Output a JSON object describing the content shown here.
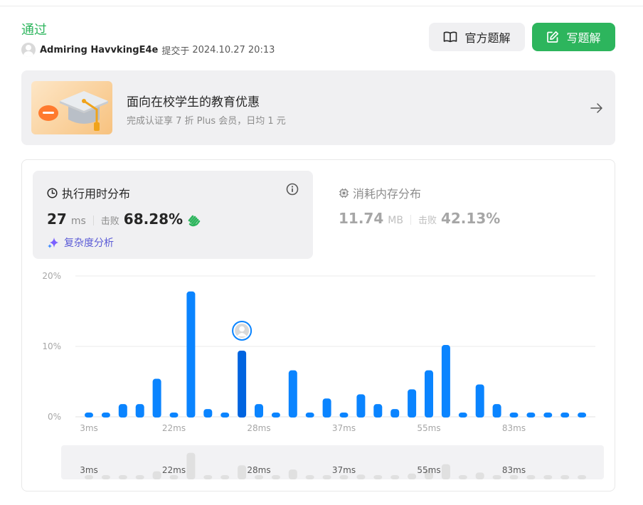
{
  "header": {
    "status": "通过",
    "username": "Admiring HavvkingE4e",
    "submitted_label": "提交于",
    "submitted_time": "2024.10.27 20:13",
    "official_solution_label": "官方题解",
    "write_solution_label": "写题解"
  },
  "banner": {
    "title": "面向在校学生的教育优惠",
    "subtitle": "完成认证享 7 折 Plus 会员，日均 1 元"
  },
  "runtime": {
    "title": "执行用时分布",
    "value": "27",
    "unit": "ms",
    "beat_label": "击败",
    "beat_value": "68.28%",
    "complexity_link": "复杂度分析"
  },
  "memory": {
    "title": "消耗内存分布",
    "value": "11.74",
    "unit": "MB",
    "beat_label": "击败",
    "beat_value": "42.13%"
  },
  "colors": {
    "accepted": "#2db55d",
    "bar": "#0a84ff",
    "bar_active": "#0064e0",
    "minimap_bar": "#e0e0e0"
  },
  "chart_data": {
    "type": "bar",
    "title": "",
    "xlabel": "",
    "ylabel": "",
    "y_ticks": [
      "0%",
      "10%",
      "20%"
    ],
    "ylim": [
      0,
      20
    ],
    "x_tick_labels": [
      {
        "index": 0,
        "label": "3ms"
      },
      {
        "index": 5,
        "label": "22ms"
      },
      {
        "index": 10,
        "label": "28ms"
      },
      {
        "index": 15,
        "label": "37ms"
      },
      {
        "index": 20,
        "label": "55ms"
      },
      {
        "index": 25,
        "label": "83ms"
      }
    ],
    "values": [
      0.5,
      0.5,
      1.8,
      1.8,
      5.4,
      0.5,
      17.8,
      1.1,
      0.5,
      9.4,
      1.8,
      0.5,
      6.6,
      0.5,
      2.6,
      0.5,
      3.2,
      1.8,
      1.1,
      3.9,
      6.6,
      10.2,
      0.5,
      4.6,
      1.8,
      0.5,
      0.5,
      0.5,
      0.5,
      0.5
    ],
    "highlight_index": 9,
    "grid": true,
    "legend": "none"
  },
  "minimap": {
    "x_tick_labels": [
      "3ms",
      "22ms",
      "28ms",
      "37ms",
      "55ms",
      "83ms"
    ]
  }
}
